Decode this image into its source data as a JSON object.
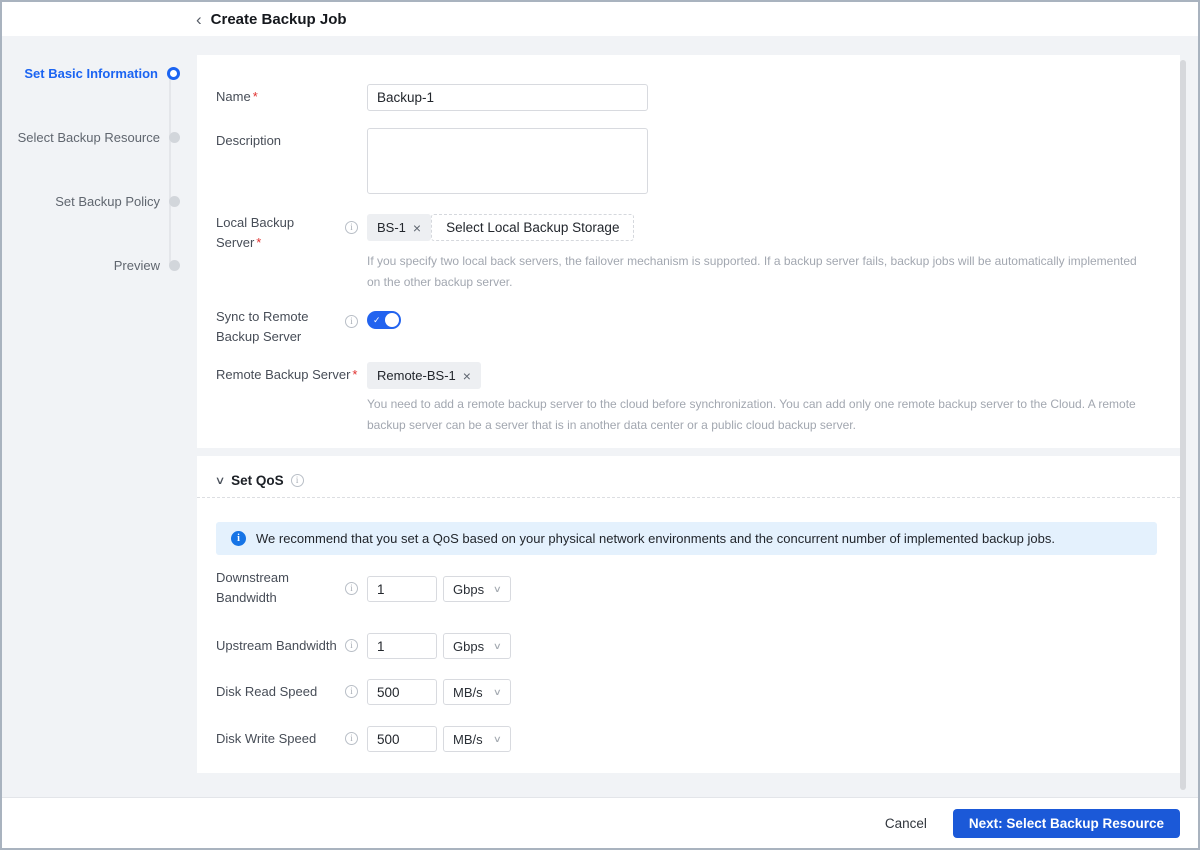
{
  "colors": {
    "accent_blue": "#1b64f2",
    "button_blue": "#1b59d8",
    "toggle_blue": "#2263ef",
    "banner_bg": "#e4f1fd",
    "banner_icon_blue": "#1674e6",
    "required_red": "#e0302e",
    "page_bg": "#f1f3f6"
  },
  "icons": {
    "back": "‹",
    "close": "×",
    "check": "✓",
    "chevron_down": "∨",
    "info": "i"
  },
  "ui": {
    "required_mark": "*"
  },
  "header": {
    "title": "Create Backup Job"
  },
  "stepper": {
    "steps": [
      {
        "label": "Set Basic Information",
        "state": "active"
      },
      {
        "label": "Select Backup Resource",
        "state": "upcoming"
      },
      {
        "label": "Set Backup Policy",
        "state": "upcoming"
      },
      {
        "label": "Preview",
        "state": "upcoming"
      }
    ]
  },
  "basic": {
    "name": {
      "label": "Name",
      "value": "Backup-1"
    },
    "description": {
      "label": "Description",
      "value": ""
    },
    "local_backup_server": {
      "label_line1": "Local Backup",
      "label_line2": "Server",
      "tag": "BS-1",
      "select_button": "Select Local Backup Storage",
      "helper": "If you specify two local back servers, the failover mechanism is supported. If a backup server fails, backup jobs will be automatically implemented on the other backup server."
    },
    "sync_to_remote": {
      "label_line1": "Sync to Remote",
      "label_line2": "Backup Server",
      "enabled": true
    },
    "remote_backup_server": {
      "label": "Remote Backup Server",
      "tag": "Remote-BS-1",
      "helper": "You need to add a remote backup server to the cloud before synchronization. You can add only one remote backup server to the Cloud. A remote backup server can be a server that is in another data center or a public cloud backup server."
    }
  },
  "qos": {
    "title": "Set QoS",
    "banner": "We recommend that you set a QoS based on your physical network environments and the concurrent number of implemented backup jobs.",
    "fields": [
      {
        "label_line1": "Downstream",
        "label_line2": "Bandwidth",
        "value": "1",
        "unit": "Gbps"
      },
      {
        "label_line1": "Upstream Bandwidth",
        "label_line2": "",
        "value": "1",
        "unit": "Gbps"
      },
      {
        "label_line1": "Disk Read Speed",
        "label_line2": "",
        "value": "500",
        "unit": "MB/s"
      },
      {
        "label_line1": "Disk Write Speed",
        "label_line2": "",
        "value": "500",
        "unit": "MB/s"
      }
    ]
  },
  "footer": {
    "cancel": "Cancel",
    "next": "Next: Select Backup Resource"
  }
}
